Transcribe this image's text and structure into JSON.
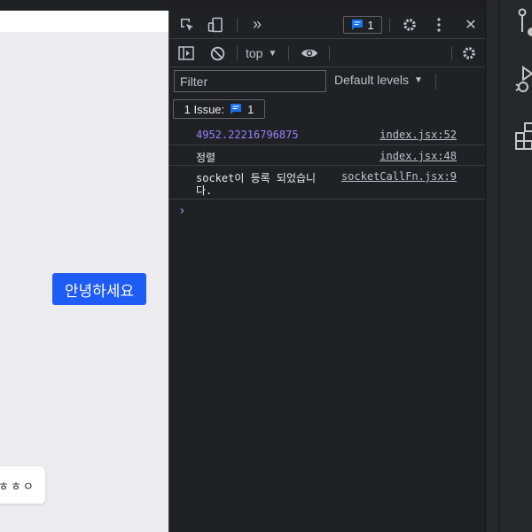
{
  "page": {
    "hello_button": "안녕하세요",
    "toast_text": "ㅎㅎㅇ"
  },
  "devtools": {
    "toolbar": {
      "inspect_icon": "inspect-icon",
      "device_icon": "device-toggle-icon",
      "more_tabs": "»",
      "messages_count": "1",
      "settings_icon": "gear-icon",
      "menu_icon": "kebab-menu-icon",
      "close": "✕"
    },
    "console_toolbar": {
      "context": "top",
      "filter_placeholder": "Filter",
      "levels": "Default levels"
    },
    "issues": {
      "label": "1 Issue:",
      "count": "1"
    },
    "messages": [
      {
        "text": "4952.22216796875",
        "source": "index.jsx:52",
        "is_number": true
      },
      {
        "text": "정렬",
        "source": "index.jsx:48",
        "is_number": false
      },
      {
        "text_line1": "socket이 등록 되었습니",
        "text_line2": "다.",
        "source": "socketCallFn.jsx:9"
      }
    ],
    "prompt": "›"
  },
  "colors": {
    "accent_button": "#1f5cf5",
    "console_number": "#9980ff",
    "badge_blue": "#1a73e8"
  }
}
